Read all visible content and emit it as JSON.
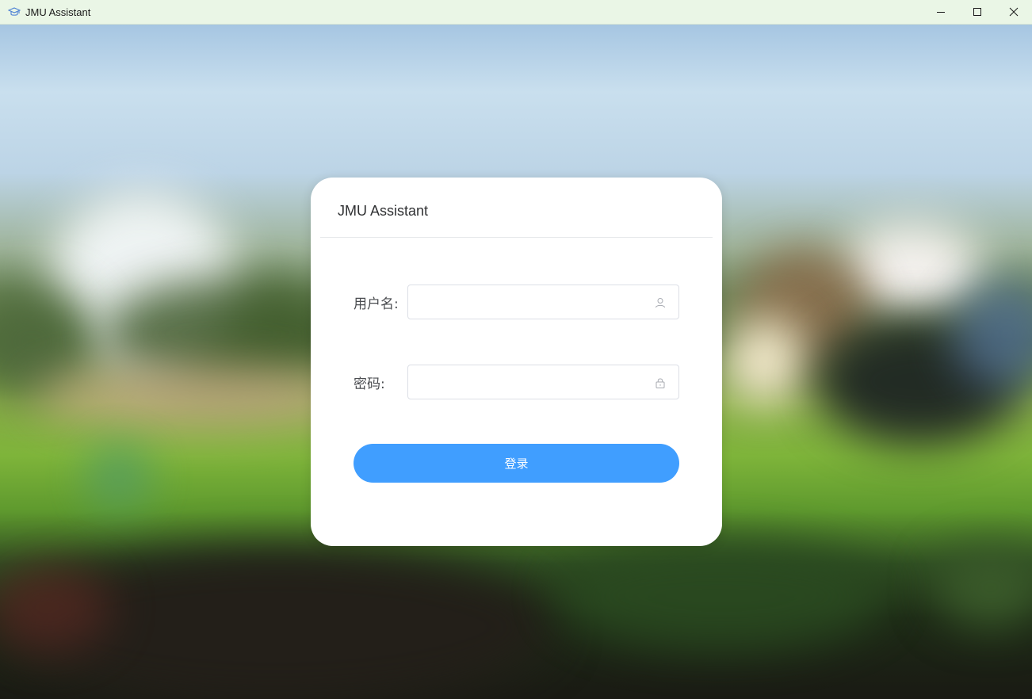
{
  "window": {
    "title": "JMU Assistant",
    "controls": {
      "minimize": "minimize",
      "maximize": "maximize",
      "close": "close"
    }
  },
  "login_card": {
    "title": "JMU Assistant",
    "username": {
      "label": "用户名:",
      "value": "",
      "placeholder": ""
    },
    "password": {
      "label": "密码:",
      "value": "",
      "placeholder": ""
    },
    "submit_label": "登录"
  },
  "colors": {
    "titlebar_bg": "#eaf6e6",
    "accent": "#409eff",
    "card_bg": "#ffffff",
    "label_text": "#4a4c50"
  },
  "icons": {
    "app": "graduation-cap-icon",
    "username_suffix": "user-icon",
    "password_suffix": "lock-icon"
  }
}
